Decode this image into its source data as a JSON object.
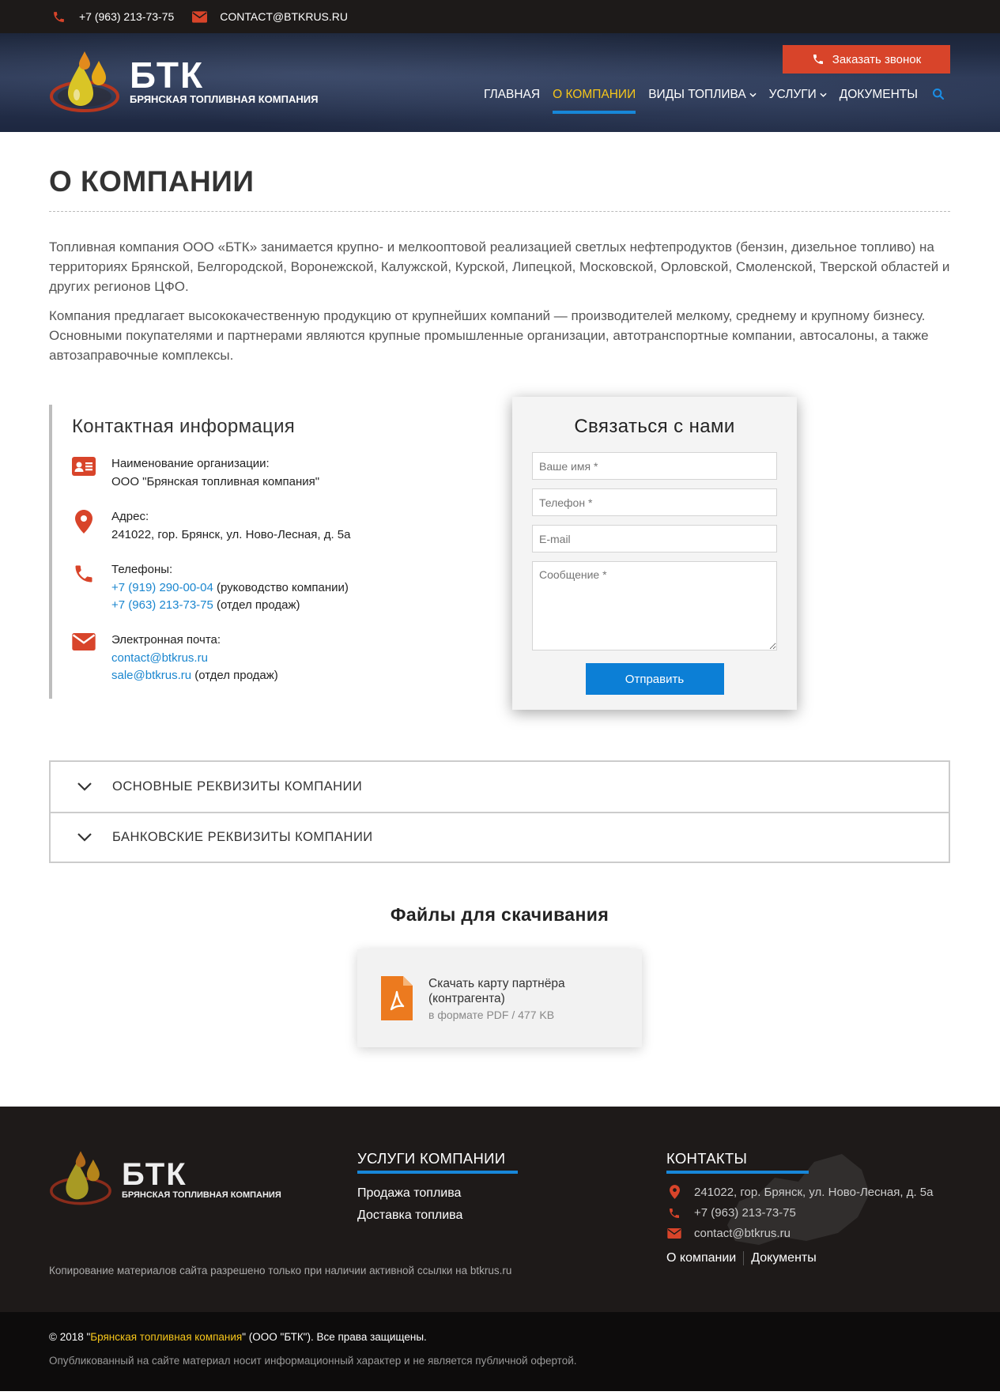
{
  "topbar": {
    "phone": "+7 (963) 213-73-75",
    "email": "CONTACT@BTKRUS.RU"
  },
  "header": {
    "logo_title": "БТК",
    "logo_subtitle": "БРЯНСКАЯ ТОПЛИВНАЯ КОМПАНИЯ",
    "callback_button": "Заказать звонок",
    "nav": [
      {
        "label": "ГЛАВНАЯ"
      },
      {
        "label": "О КОМПАНИИ",
        "active": true
      },
      {
        "label": "ВИДЫ ТОПЛИВА"
      },
      {
        "label": "УСЛУГИ"
      },
      {
        "label": "ДОКУМЕНТЫ"
      }
    ]
  },
  "main": {
    "title": "О КОМПАНИИ",
    "paragraphs": [
      "Топливная компания ООО «БТК» занимается крупно- и мелкооптовой реализацией светлых нефтепродуктов (бензин, дизельное топливо) на территориях Брянской, Белгородской, Воронежской, Калужской, Курской, Липецкой, Московской, Орловской, Смоленской, Тверской областей и других регионов ЦФО.",
      "Компания предлагает высококачественную продукцию от крупнейших компаний — производителей мелкому, среднему и крупному бизнесу. Основными покупателями и партнерами являются крупные промышленные организации, автотранспортные компании, автосалоны, а также автозаправочные комплексы."
    ]
  },
  "contacts": {
    "title": "Контактная информация",
    "org_label": "Наименование организации:",
    "org_value": "ООО \"Брянская топливная компания\"",
    "address_label": "Адрес:",
    "address_value": "241022, гор. Брянск, ул. Ново-Лесная, д. 5а",
    "phones_label": "Телефоны:",
    "phone1": "+7 (919) 290-00-04",
    "phone1_note": " (руководство компании)",
    "phone2": "+7 (963) 213-73-75",
    "phone2_note": " (отдел продаж)",
    "email_label": "Электронная почта:",
    "email1": "contact@btkrus.ru",
    "email2": "sale@btkrus.ru",
    "email2_note": " (отдел продаж)"
  },
  "form": {
    "title": "Связаться с нами",
    "name_placeholder": "Ваше имя *",
    "phone_placeholder": "Телефон *",
    "email_placeholder": "E-mail",
    "message_placeholder": "Сообщение *",
    "submit": "Отправить"
  },
  "accordion": [
    {
      "label": "ОСНОВНЫЕ РЕКВИЗИТЫ КОМПАНИИ"
    },
    {
      "label": "БАНКОВСКИЕ РЕКВИЗИТЫ КОМПАНИИ"
    }
  ],
  "files": {
    "title": "Файлы для скачивания",
    "file_name": "Скачать карту партнёра (контрагента)",
    "file_meta": "в формате PDF / 477 KB"
  },
  "footer": {
    "logo_title": "БТК",
    "logo_subtitle": "БРЯНСКАЯ ТОПЛИВНАЯ КОМПАНИЯ",
    "copy_note": "Копирование материалов сайта разрешено только при наличии активной ссылки на btkrus.ru",
    "services_title": "УСЛУГИ КОМПАНИИ",
    "services": [
      "Продажа топлива",
      "Доставка топлива"
    ],
    "contacts_title": "КОНТАКТЫ",
    "address": "241022, гор. Брянск, ул. Ново-Лесная, д. 5а",
    "phone": "+7 (963) 213-73-75",
    "email": "contact@btkrus.ru",
    "link_about": "О компании",
    "link_docs": "Документы"
  },
  "bottom": {
    "copyright_prefix": "© 2018 \"",
    "copyright_company": "Брянская топливная компания",
    "copyright_suffix": "\" (ООО \"БТК\"). Все права защищены.",
    "disclaimer": "Опубликованный на сайте материал носит информационный характер и не является публичной офертой."
  },
  "colors": {
    "accent_red": "#d8442a",
    "accent_blue": "#1787d9",
    "accent_yellow": "#f6c61a",
    "dark": "#1d1a19"
  },
  "icons": [
    "phone-icon",
    "envelope-icon",
    "search-icon",
    "chevron-down-icon",
    "id-card-icon",
    "map-pin-icon",
    "pdf-file-icon",
    "logo-drops"
  ]
}
